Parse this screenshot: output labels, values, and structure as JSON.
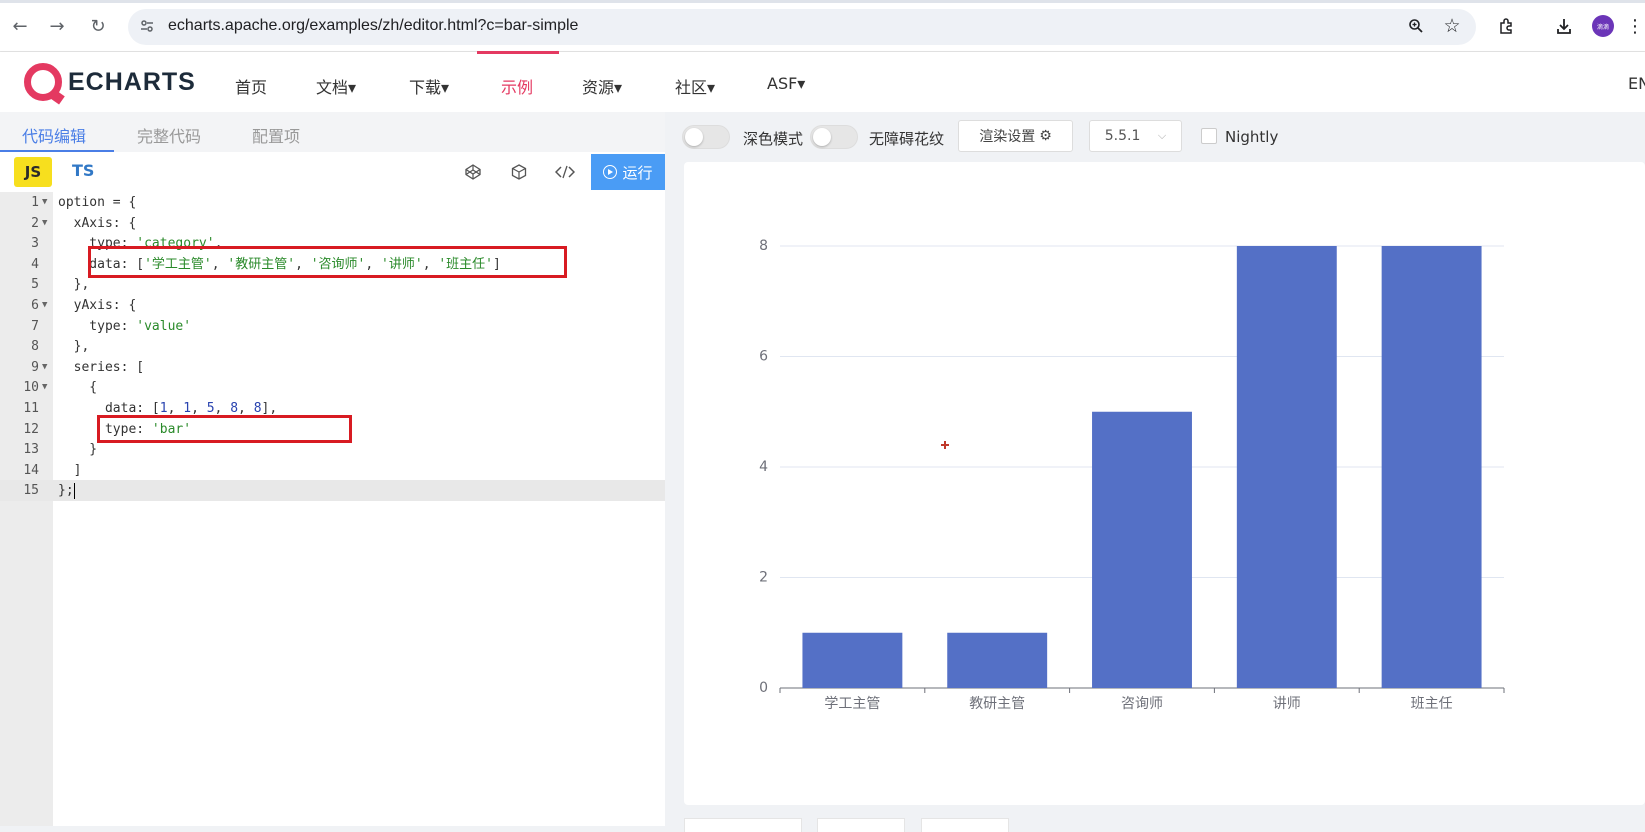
{
  "browser": {
    "url": "echarts.apache.org/examples/zh/editor.html?c=bar-simple",
    "back_icon": "back-arrow-icon",
    "forward_icon": "forward-arrow-icon",
    "reload_icon": "reload-icon",
    "avatar_text": "滴滴"
  },
  "site_nav": {
    "logo_text": "ECHARTS",
    "items": [
      "首页",
      "文档▾",
      "下载▾",
      "示例",
      "资源▾",
      "社区▾",
      "ASF▾"
    ],
    "active": "示例",
    "lang": "EN"
  },
  "editor": {
    "tabs": [
      "代码编辑",
      "完整代码",
      "配置项"
    ],
    "active_tab": "代码编辑",
    "langs": [
      "JS",
      "TS"
    ],
    "run_label": "运行",
    "code_lines": [
      "option = {",
      "  xAxis: {",
      "    type: 'category',",
      "    data: ['学工主管', '教研主管', '咨询师', '讲师', '班主任']",
      "  },",
      "  yAxis: {",
      "    type: 'value'",
      "  },",
      "  series: [",
      "    {",
      "      data: [1, 1, 5, 8, 8],",
      "      type: 'bar'",
      "    }",
      "  ]",
      "};"
    ],
    "current_line": 15,
    "foldable_lines": [
      1,
      2,
      6,
      9,
      10
    ]
  },
  "preview_toolbar": {
    "dark_mode_label": "深色模式",
    "decal_label": "无障碍花纹",
    "render_settings_label": "渲染设置",
    "version": "5.5.1",
    "nightly_label": "Nightly"
  },
  "chart_data": {
    "type": "bar",
    "categories": [
      "学工主管",
      "教研主管",
      "咨询师",
      "讲师",
      "班主任"
    ],
    "values": [
      1,
      1,
      5,
      8,
      8
    ],
    "ylim": [
      0,
      8
    ],
    "yticks": [
      0,
      2,
      4,
      6,
      8
    ],
    "bar_color": "#5470c6",
    "grid": true
  },
  "colors": {
    "brand": "#e43961",
    "accent": "#4a7ee6",
    "highlight_box": "#d81b22"
  }
}
